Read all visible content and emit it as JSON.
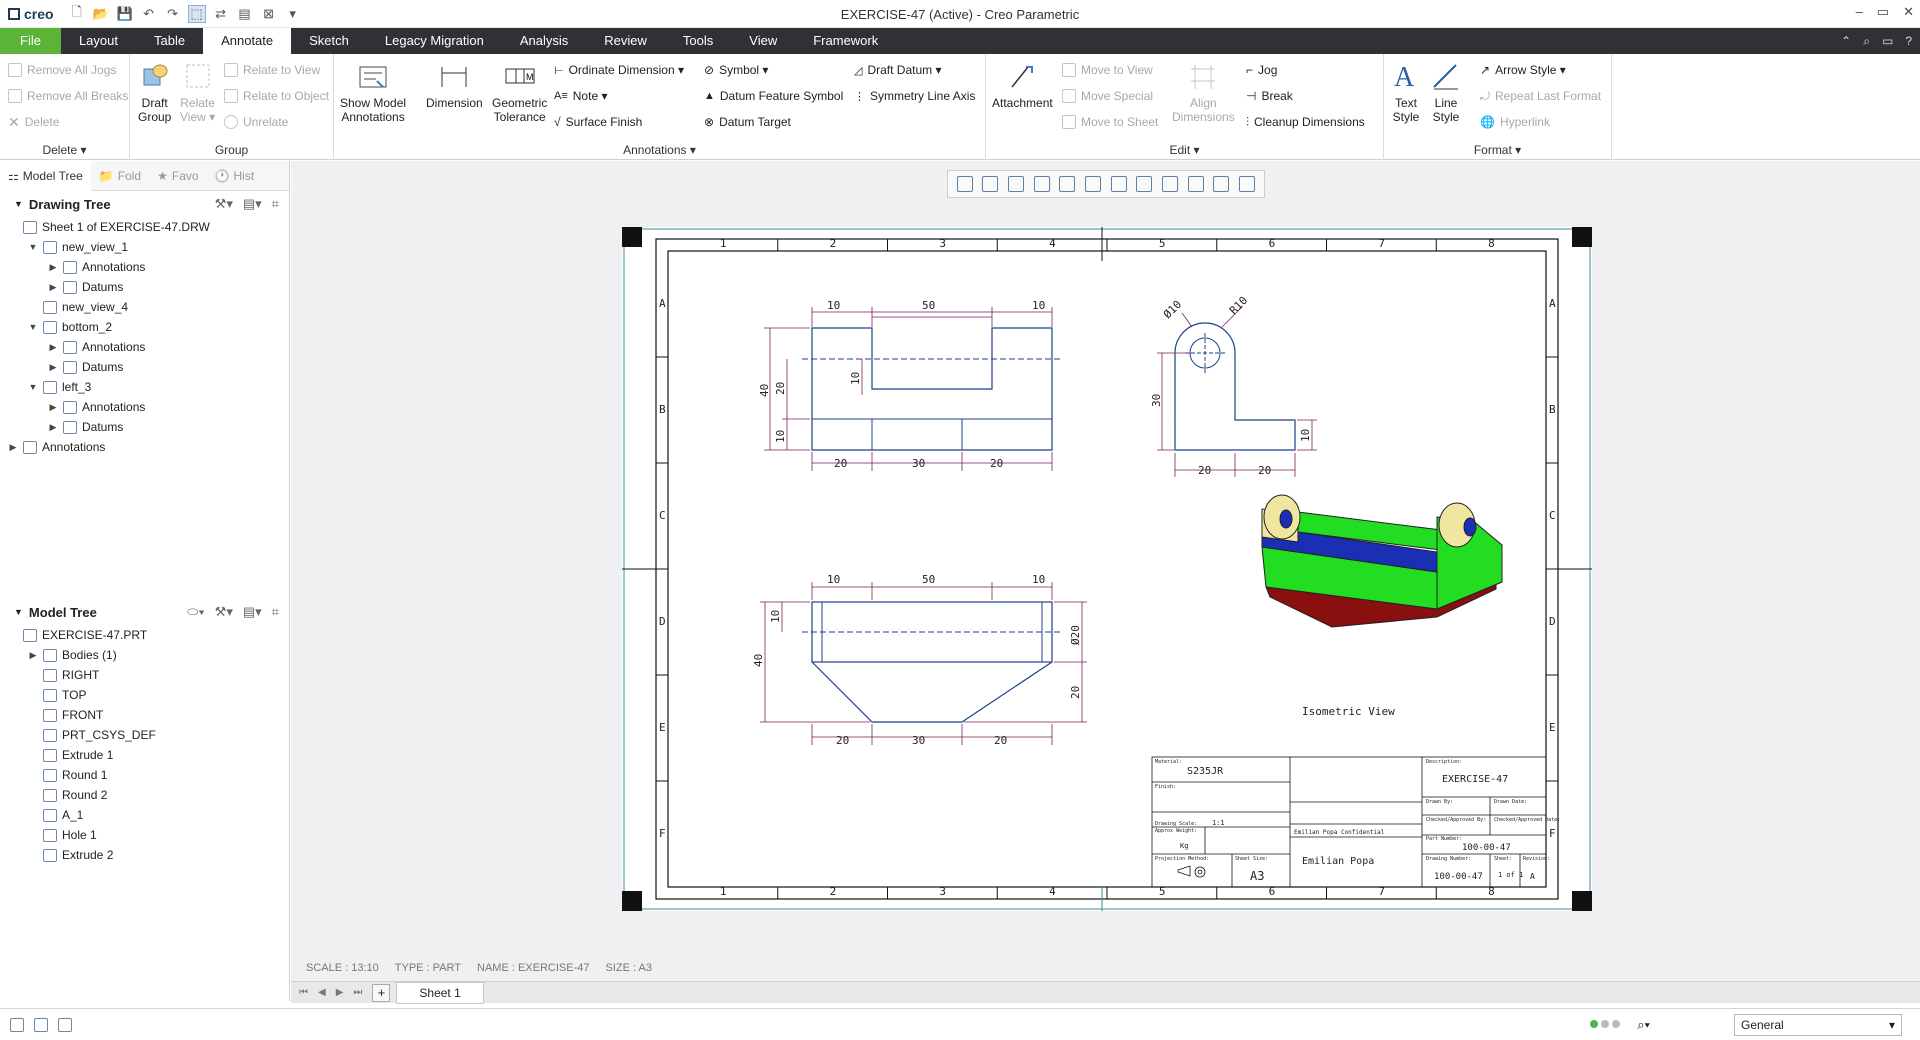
{
  "window": {
    "app_logo": "creo",
    "title": "EXERCISE-47 (Active) - Creo Parametric",
    "controls": [
      "–",
      "▭",
      "✕"
    ]
  },
  "tabs": [
    {
      "label": "File",
      "state": "file"
    },
    {
      "label": "Layout",
      "state": ""
    },
    {
      "label": "Table",
      "state": ""
    },
    {
      "label": "Annotate",
      "state": "active"
    },
    {
      "label": "Sketch",
      "state": ""
    },
    {
      "label": "Legacy Migration",
      "state": ""
    },
    {
      "label": "Analysis",
      "state": ""
    },
    {
      "label": "Review",
      "state": ""
    },
    {
      "label": "Tools",
      "state": ""
    },
    {
      "label": "View",
      "state": ""
    },
    {
      "label": "Framework",
      "state": ""
    }
  ],
  "ribbon": {
    "delete_group": {
      "label": "Delete ▾",
      "remove_all_jogs": "Remove All Jogs",
      "remove_all_breaks": "Remove All Breaks",
      "delete": "Delete"
    },
    "group_group": {
      "label": "Group",
      "draft_group_1": "Draft",
      "draft_group_2": "Group",
      "relate_view_1": "Relate",
      "relate_view_2": "View ▾",
      "relate_to_view": "Relate to View",
      "relate_to_object": "Relate to Object",
      "unrelate": "Unrelate"
    },
    "annotations_group": {
      "label": "Annotations ▾",
      "show_model_1": "Show Model",
      "show_model_2": "Annotations",
      "dimension": "Dimension",
      "geometric_1": "Geometric",
      "geometric_2": "Tolerance",
      "ordinate_dimension": "Ordinate Dimension ▾",
      "note": "Note ▾",
      "surface_finish": "Surface Finish",
      "symbol": "Symbol ▾",
      "datum_feature_symbol": "Datum Feature Symbol",
      "datum_target": "Datum Target",
      "draft_datum": "Draft Datum ▾",
      "symmetry_line_axis": "Symmetry Line Axis"
    },
    "edit_group": {
      "label": "Edit ▾",
      "attachment": "Attachment",
      "move_to_view": "Move to View",
      "move_special": "Move Special",
      "move_to_sheet": "Move to Sheet",
      "align_1": "Align",
      "align_2": "Dimensions",
      "jog": "Jog",
      "break": "Break",
      "cleanup_dimensions": "Cleanup Dimensions"
    },
    "format_group": {
      "label": "Format ▾",
      "text_style_1": "Text",
      "text_style_2": "Style",
      "line_style_1": "Line",
      "line_style_2": "Style",
      "arrow_style": "Arrow Style ▾",
      "repeat_last_format": "Repeat Last Format",
      "hyperlink": "Hyperlink"
    }
  },
  "panel_tabs": [
    "Model Tree",
    "Fold",
    "Favo",
    "Hist"
  ],
  "drawing_tree": {
    "header": "Drawing Tree",
    "nodes": [
      {
        "label": "Sheet 1 of EXERCISE-47.DRW",
        "indent": 0,
        "twisty": ""
      },
      {
        "label": "new_view_1",
        "indent": 1,
        "twisty": "▼"
      },
      {
        "label": "Annotations",
        "indent": 2,
        "twisty": "▶"
      },
      {
        "label": "Datums",
        "indent": 2,
        "twisty": "▶"
      },
      {
        "label": "new_view_4",
        "indent": 1,
        "twisty": ""
      },
      {
        "label": "bottom_2",
        "indent": 1,
        "twisty": "▼"
      },
      {
        "label": "Annotations",
        "indent": 2,
        "twisty": "▶"
      },
      {
        "label": "Datums",
        "indent": 2,
        "twisty": "▶"
      },
      {
        "label": "left_3",
        "indent": 1,
        "twisty": "▼"
      },
      {
        "label": "Annotations",
        "indent": 2,
        "twisty": "▶"
      },
      {
        "label": "Datums",
        "indent": 2,
        "twisty": "▶"
      },
      {
        "label": "Annotations",
        "indent": 0,
        "twisty": "▶"
      }
    ]
  },
  "model_tree": {
    "header": "Model Tree",
    "nodes": [
      {
        "label": "EXERCISE-47.PRT",
        "indent": 0,
        "twisty": ""
      },
      {
        "label": "Bodies (1)",
        "indent": 1,
        "twisty": "▶"
      },
      {
        "label": "RIGHT",
        "indent": 1,
        "twisty": ""
      },
      {
        "label": "TOP",
        "indent": 1,
        "twisty": ""
      },
      {
        "label": "FRONT",
        "indent": 1,
        "twisty": ""
      },
      {
        "label": "PRT_CSYS_DEF",
        "indent": 1,
        "twisty": ""
      },
      {
        "label": "Extrude 1",
        "indent": 1,
        "twisty": ""
      },
      {
        "label": "Round 1",
        "indent": 1,
        "twisty": ""
      },
      {
        "label": "Round 2",
        "indent": 1,
        "twisty": ""
      },
      {
        "label": "A_1",
        "indent": 1,
        "twisty": ""
      },
      {
        "label": "Hole 1",
        "indent": 1,
        "twisty": ""
      },
      {
        "label": "Extrude 2",
        "indent": 1,
        "twisty": ""
      }
    ]
  },
  "drawing": {
    "top_zones": [
      "1",
      "2",
      "3",
      "4",
      "5",
      "6",
      "7",
      "8"
    ],
    "side_zones": [
      "A",
      "B",
      "C",
      "D",
      "E",
      "F"
    ],
    "front_view_dims": [
      "10",
      "50",
      "10",
      "40",
      "20",
      "10",
      "10",
      "20",
      "30",
      "20"
    ],
    "side_view_dims": [
      "Ø10",
      "R10",
      "30",
      "10",
      "20",
      "20"
    ],
    "top_view_dims": [
      "10",
      "50",
      "10",
      "40",
      "10",
      "Ø20",
      "20",
      "20",
      "30",
      "20"
    ],
    "isometric_label": "Isometric View",
    "title_block": {
      "material_label": "Material:",
      "material": "S235JR",
      "finish_label": "Finish:",
      "scale_label": "Drawing Scale:",
      "scale_value": "1:1",
      "weight_label": "Approx Weight:",
      "weight_value": "Kg",
      "projection_label": "Projection Method:",
      "sheet_size_label": "Sheet Size:",
      "sheet_size": "A3",
      "company": "Emilian Popa",
      "confidential": "Emilian Popa Confidential",
      "description_label": "Description:",
      "description": "EXERCISE-47",
      "drawn_by_label": "Drawn By:",
      "date_label": "Drawn Date:",
      "checked_label": "Checked/Approved By:",
      "checked_date_label": "Checked/Approved Date:",
      "part_number_label": "Part Number:",
      "part_number": "100-00-47",
      "drawing_number_label": "Drawing Number:",
      "drawing_number": "100-00-47",
      "sheet_label": "Sheet:",
      "sheet_value": "1 of 1",
      "revision_label": "Revision:",
      "revision": "A"
    },
    "colors": {
      "border": "#1a1a1a",
      "geometry": "#1f3f8c",
      "dimension": "#7b1e5a",
      "iso_green": "#22dd22",
      "iso_blue": "#1a2fb3",
      "iso_red": "#a01818",
      "iso_yellow": "#f0e6a0"
    }
  },
  "status_line": {
    "scale": "SCALE : 13:10",
    "type": "TYPE : PART",
    "name": "NAME : EXERCISE-47",
    "size": "SIZE : A3"
  },
  "sheet_tab": "Sheet 1",
  "filter_value": "General"
}
